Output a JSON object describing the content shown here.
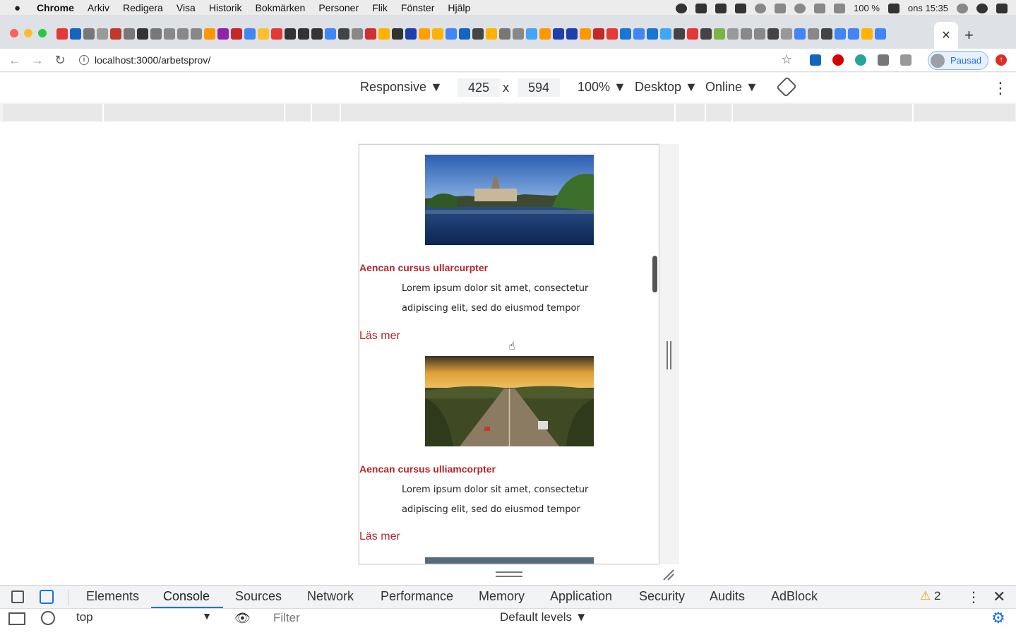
{
  "menubar": {
    "apple": "",
    "items": [
      "Chrome",
      "Arkiv",
      "Redigera",
      "Visa",
      "Historik",
      "Bokmärken",
      "Personer",
      "Flik",
      "Fönster",
      "Hjälp"
    ],
    "battery": "100 %",
    "clock": "ons 15:35"
  },
  "browser": {
    "tab_close": "✕",
    "new_tab": "+",
    "url": "localhost:3000/arbetsprov/",
    "profile_label": "Pausad"
  },
  "device_toolbar": {
    "device": "Responsive ▼",
    "width": "425",
    "times": "x",
    "height": "594",
    "zoom": "100% ▼",
    "mode": "Desktop ▼",
    "network": "Online ▼"
  },
  "page": {
    "cards": [
      {
        "image": "lake-town-photo",
        "title": "Aencan cursus ullarcurpter",
        "text": "Lorem ipsum dolor sit amet, consectetur adipiscing elit, sed do eiusmod tempor",
        "link": "Läs mer"
      },
      {
        "image": "highway-sunset-photo",
        "title": "Aencan cursus ulliamcorpter",
        "text": "Lorem ipsum dolor sit amet, consectetur adipiscing elit, sed do eiusmod tempor",
        "link": "Läs mer"
      }
    ]
  },
  "devtools": {
    "tabs": [
      "Elements",
      "Console",
      "Sources",
      "Network",
      "Performance",
      "Memory",
      "Application",
      "Security",
      "Audits",
      "AdBlock"
    ],
    "active_tab": "Console",
    "warning_count": "2",
    "context": "top",
    "filter_placeholder": "Filter",
    "levels": "Default levels ▼"
  },
  "colors": {
    "accent": "#b3262b",
    "devtools_blue": "#1a73e8"
  }
}
